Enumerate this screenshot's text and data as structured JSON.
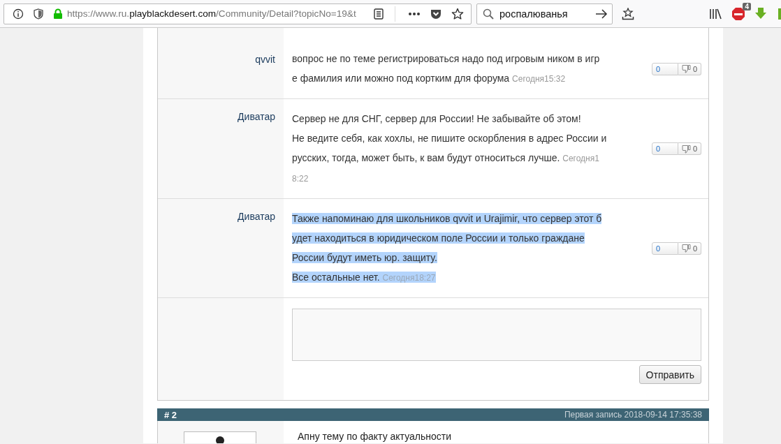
{
  "browser": {
    "url_prefix": "https://www.ru.",
    "url_domain": "playblackdesert.com",
    "url_path": "/Community/Detail?topicNo=19&t",
    "search_value": "роспалюванья",
    "addon_badge": "4"
  },
  "comments": [
    {
      "author": "qvvit",
      "highlighted": false,
      "lines": [
        [
          {
            "kind": "body",
            "text": "вопрос не по теме регистрироваться надо под игровым ником в игр"
          }
        ],
        [
          {
            "kind": "body",
            "text": "е фамилия или можно под кортким для форума "
          },
          {
            "kind": "date",
            "text": "Сегодня15:32"
          }
        ]
      ],
      "likes": "0",
      "dislikes": "0"
    },
    {
      "author": "Диватар",
      "highlighted": false,
      "lines": [
        [
          {
            "kind": "body",
            "text": "Сервер не для СНГ, сервер для России! Не забывайте об этом!"
          }
        ],
        [
          {
            "kind": "body",
            "text": "Не ведите себя, как хохлы, не пишите оскорбления в адрес России и"
          }
        ],
        [
          {
            "kind": "body",
            "text": "русских, тогда, может быть, к вам будут относиться лучше. "
          },
          {
            "kind": "date",
            "text": "Сегодня1"
          }
        ],
        [
          {
            "kind": "date",
            "text": "8:22"
          }
        ]
      ],
      "likes": "0",
      "dislikes": "0"
    },
    {
      "author": "Диватар",
      "highlighted": true,
      "lines": [
        [
          {
            "kind": "body",
            "text": "Также напоминаю для школьников qvvit и Urajimir, что сервер этот б"
          }
        ],
        [
          {
            "kind": "body",
            "text": "удет находиться в юридическом поле России и только граждане "
          }
        ],
        [
          {
            "kind": "body",
            "text": "России будут иметь юр. защиту."
          }
        ],
        [
          {
            "kind": "body",
            "text": "Все остальные нет. "
          },
          {
            "kind": "date",
            "text": "Сегодня18:27"
          }
        ]
      ],
      "likes": "0",
      "dislikes": "0"
    }
  ],
  "reply": {
    "send_button": "Отправить"
  },
  "next_post": {
    "number": "# 2",
    "first_entry": "Первая запись 2018-09-14 17:35:38",
    "text": "Апну тему по факту актуальности"
  }
}
